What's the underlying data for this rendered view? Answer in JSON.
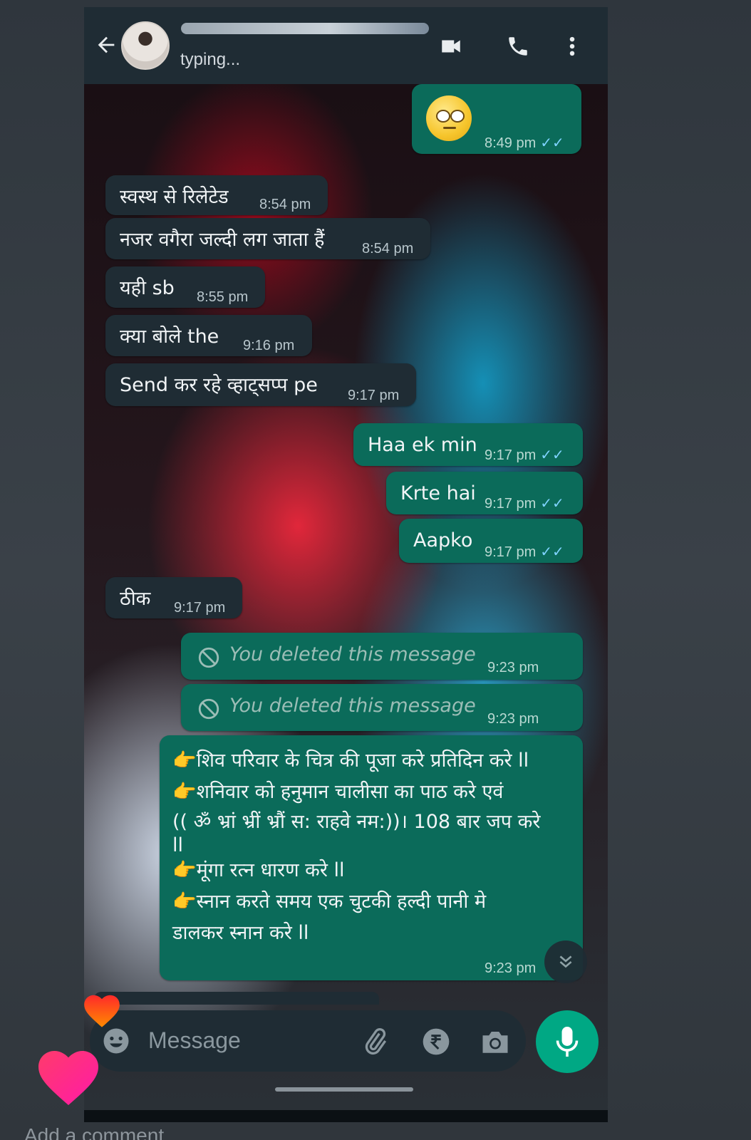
{
  "header": {
    "contact_name": "",
    "status": "typing..."
  },
  "messages": [
    {
      "dir": "out",
      "emoji": "face-with-rolling-eyes",
      "time": "8:49 pm"
    },
    {
      "dir": "in",
      "text": "स्वस्थ से रिलेटेड",
      "time": "8:54 pm"
    },
    {
      "dir": "in",
      "text": "नजर वगैरा जल्दी लग जाता हैं",
      "time": "8:54 pm"
    },
    {
      "dir": "in",
      "text": "यही sb",
      "time": "8:55 pm"
    },
    {
      "dir": "in",
      "text": "क्या बोले the",
      "time": "9:16 pm"
    },
    {
      "dir": "in",
      "text": "Send कर रहे व्हाट्सप्प pe",
      "time": "9:17 pm"
    },
    {
      "dir": "out",
      "text": "Haa ek min",
      "time": "9:17 pm"
    },
    {
      "dir": "out",
      "text": "Krte hai",
      "time": "9:17 pm"
    },
    {
      "dir": "out",
      "text": "Aapko",
      "time": "9:17 pm"
    },
    {
      "dir": "in",
      "text": "ठीक",
      "time": "9:17 pm"
    },
    {
      "dir": "out",
      "deleted": true,
      "text": "You deleted this message",
      "time": "9:23 pm"
    },
    {
      "dir": "out",
      "deleted": true,
      "text": "You deleted this message",
      "time": "9:23 pm"
    },
    {
      "dir": "out",
      "lines": [
        "👉शिव परिवार के चित्र की पूजा करे प्रतिदिन करे ll",
        "👉शनिवार को हनुमान चालीसा का पाठ करे एवं",
        "(( ॐ भ्रां भ्रीं भ्रौं स: राहवे नम:))। 108 बार जप करे",
        "ll",
        "👉मूंगा रत्न धारण करे ll",
        "👉स्नान करते समय एक चुटकी हल्दी पानी मे",
        "डालकर स्नान करे ll"
      ],
      "time": "9:23 pm"
    }
  ],
  "ticks": "✓✓",
  "composer": {
    "placeholder": "Message"
  },
  "overlay": {
    "add_comment": "Add a comment..."
  },
  "colors": {
    "header_bg": "#1f2c34",
    "incoming_bubble": "#1f2c34",
    "outgoing_bubble": "#0b6b5a",
    "read_ticks": "#7fd3ff",
    "mic_button": "#00a884"
  },
  "icons": [
    "back-arrow-icon",
    "video-call-icon",
    "voice-call-icon",
    "more-vert-icon",
    "deleted-icon",
    "emoji-icon",
    "attach-icon",
    "rupee-icon",
    "camera-icon",
    "mic-icon",
    "chevron-double-down-icon",
    "heart-icon"
  ]
}
